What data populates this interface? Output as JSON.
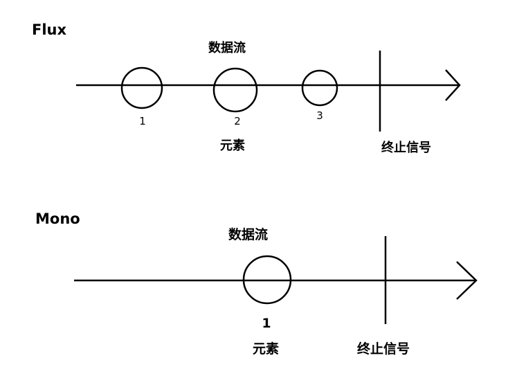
{
  "colors": {
    "background": "#ffffff",
    "ink": "#000000"
  },
  "flux": {
    "title": "Flux",
    "stream_label": "数据流",
    "elements": [
      "1",
      "2",
      "3"
    ],
    "element_label": "元素",
    "terminal_label": "终止信号"
  },
  "mono": {
    "title": "Mono",
    "stream_label": "数据流",
    "elements": [
      "1"
    ],
    "element_label": "元素",
    "terminal_label": "终止信号"
  }
}
